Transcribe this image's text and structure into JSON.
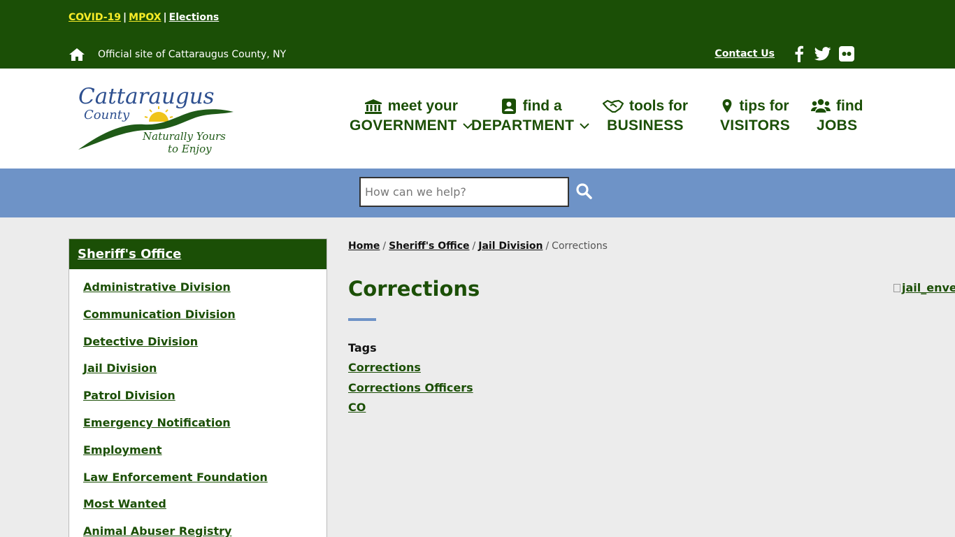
{
  "alerts": {
    "covid": "COVID-19",
    "mpox": "MPOX",
    "elections": "Elections",
    "separator": "|"
  },
  "official_site": "Official site of Cattaraugus County, NY",
  "contact_us": "Contact Us",
  "logo": {
    "line1": "Cattaraugus",
    "line2": "County",
    "tagline1": "Naturally Yours",
    "tagline2": "to Enjoy"
  },
  "nav": [
    {
      "top": "meet your",
      "bottom": "GOVERNMENT",
      "icon": "government-building-icon",
      "dropdown": true
    },
    {
      "top": "find a",
      "bottom": "DEPARTMENT",
      "icon": "address-book-icon",
      "dropdown": true
    },
    {
      "top": "tools for",
      "bottom": "BUSINESS",
      "icon": "handshake-icon",
      "dropdown": false
    },
    {
      "top": "tips for",
      "bottom": "VISITORS",
      "icon": "map-marker-icon",
      "dropdown": false
    },
    {
      "top": "find",
      "bottom": "JOBS",
      "icon": "users-icon",
      "dropdown": false
    }
  ],
  "search": {
    "placeholder": "How can we help?"
  },
  "sidebar": {
    "title": "Sheriff's Office",
    "items": [
      "Administrative Division",
      "Communication Division",
      "Detective Division",
      "Jail Division",
      "Patrol Division",
      "Emergency Notification",
      "Employment",
      "Law Enforcement Foundation",
      "Most Wanted",
      "Animal Abuser Registry"
    ]
  },
  "breadcrumb": {
    "home": "Home",
    "sheriff": "Sheriff's Office",
    "jail": "Jail Division",
    "current": "Corrections",
    "separator": "/"
  },
  "main": {
    "title": "Corrections",
    "tags_label": "Tags",
    "tags": [
      "Corrections",
      "Corrections Officers",
      "CO"
    ],
    "image_alt": "jail_envelope"
  },
  "colors": {
    "brand_green": "#1b4f06",
    "accent_blue": "#6e93c7",
    "alert_yellow": "#f7ec27"
  }
}
